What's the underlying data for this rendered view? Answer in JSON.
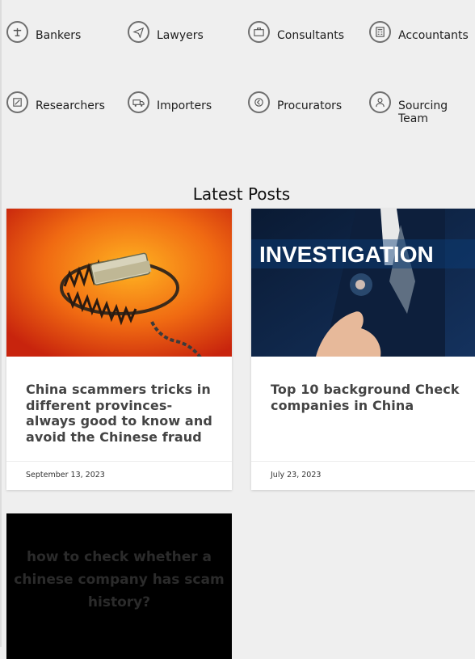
{
  "audiences": [
    {
      "label": "Bankers",
      "icon": "bank-icon"
    },
    {
      "label": "Lawyers",
      "icon": "paper-plane-icon"
    },
    {
      "label": "Consultants",
      "icon": "briefcase-icon"
    },
    {
      "label": "Accountants",
      "icon": "calculator-icon"
    },
    {
      "label": "Researchers",
      "icon": "research-icon"
    },
    {
      "label": "Importers",
      "icon": "truck-icon"
    },
    {
      "label": "Procurators",
      "icon": "arrow-left-circle-icon"
    },
    {
      "label": "Sourcing Team",
      "icon": "user-icon"
    }
  ],
  "section_title": "Latest Posts",
  "posts": [
    {
      "title": "China scammers tricks in different provinces- always good to know and avoid the Chinese fraud",
      "date": "September 13, 2023"
    },
    {
      "title": "Top 10 background Check companies in China",
      "date": "July 23, 2023",
      "image_text": "INVESTIGATION"
    },
    {
      "image_text": "how to check whether a chinese company has scam history?"
    }
  ],
  "colors": {
    "page_bg": "#efefef",
    "icon_border": "#6f6f6f",
    "title_text": "#444444"
  }
}
